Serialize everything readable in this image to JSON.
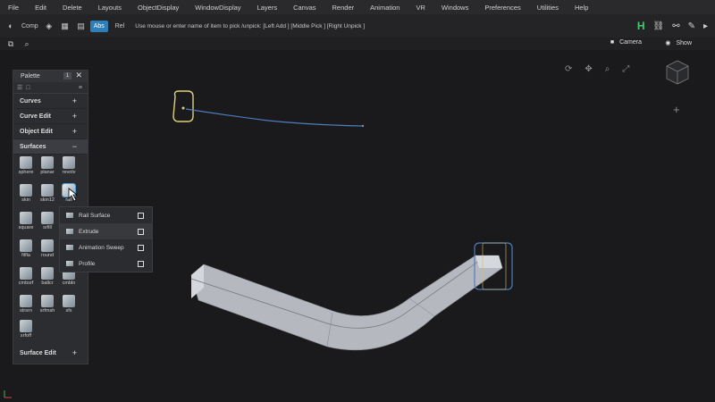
{
  "menu": [
    "File",
    "Edit",
    "Delete",
    "Layouts",
    "ObjectDisplay",
    "WindowDisplay",
    "Layers",
    "Canvas",
    "Render",
    "Animation",
    "VR",
    "Windows",
    "Preferences",
    "Utilities",
    "Help"
  ],
  "toolbar": {
    "comp_label": "Comp",
    "abs_label": "Abs",
    "rel_label": "Rel",
    "hint": "Use mouse or enter name of item to pick /unpick: [Left Add ] [Middle Pick ] [Right Unpick ]",
    "h_label": "H"
  },
  "subbar": {
    "camera_label": "Camera",
    "show_label": "Show"
  },
  "palette": {
    "title": "Palette",
    "badge": "1",
    "sections": {
      "curves": "Curves",
      "curve_edit": "Curve Edit",
      "object_edit": "Object Edit",
      "surfaces": "Surfaces",
      "surface_edit": "Surface Edit"
    },
    "tools": [
      "sphere",
      "planar",
      "revolv",
      "skin",
      "skin12",
      "rail",
      "square",
      "srfill",
      "filfla",
      "round",
      "cmbsrf",
      "ballcr",
      "cmbln",
      "strsrn",
      "srfmsh",
      "sfs",
      "srfoff"
    ]
  },
  "popup": {
    "items": [
      "Rail Surface",
      "Extrude",
      "Animation Sweep",
      "Profile"
    ]
  },
  "colors": {
    "accent": "#2c7fb8",
    "h_icon": "#3ccf6a",
    "curve": "#4d7dbe",
    "selection": "#e0d27a"
  }
}
